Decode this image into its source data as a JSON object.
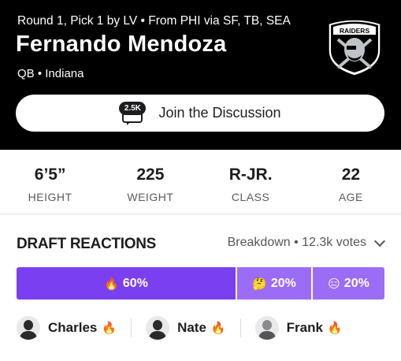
{
  "header": {
    "pick_info": "Round 1, Pick 1 by LV • From PHI via SF, TB, SEA",
    "player_name": "Fernando Mendoza",
    "player_meta": "QB • Indiana",
    "team_logo_text": "RAIDERS",
    "discussion": {
      "count": "2.5K",
      "label": "Join the Discussion"
    }
  },
  "stats": [
    {
      "value": "6’5”",
      "label": "HEIGHT"
    },
    {
      "value": "225",
      "label": "WEIGHT"
    },
    {
      "value": "R-JR.",
      "label": "CLASS"
    },
    {
      "value": "22",
      "label": "AGE"
    }
  ],
  "reactions": {
    "title": "DRAFT REACTIONS",
    "breakdown": "Breakdown • 12.3k votes",
    "segments": [
      {
        "emoji": "🔥",
        "percent": "60%",
        "value": 60,
        "color": "#7b3ff2"
      },
      {
        "emoji": "🤔",
        "percent": "20%",
        "value": 20,
        "color": "#9b6cf6"
      },
      {
        "emoji": "😑",
        "percent": "20%",
        "value": 20,
        "color": "#9b6cf6"
      }
    ],
    "reactors": [
      {
        "name": "Charles",
        "emoji": "🔥"
      },
      {
        "name": "Nate",
        "emoji": "🔥"
      },
      {
        "name": "Frank",
        "emoji": "🔥"
      }
    ]
  }
}
